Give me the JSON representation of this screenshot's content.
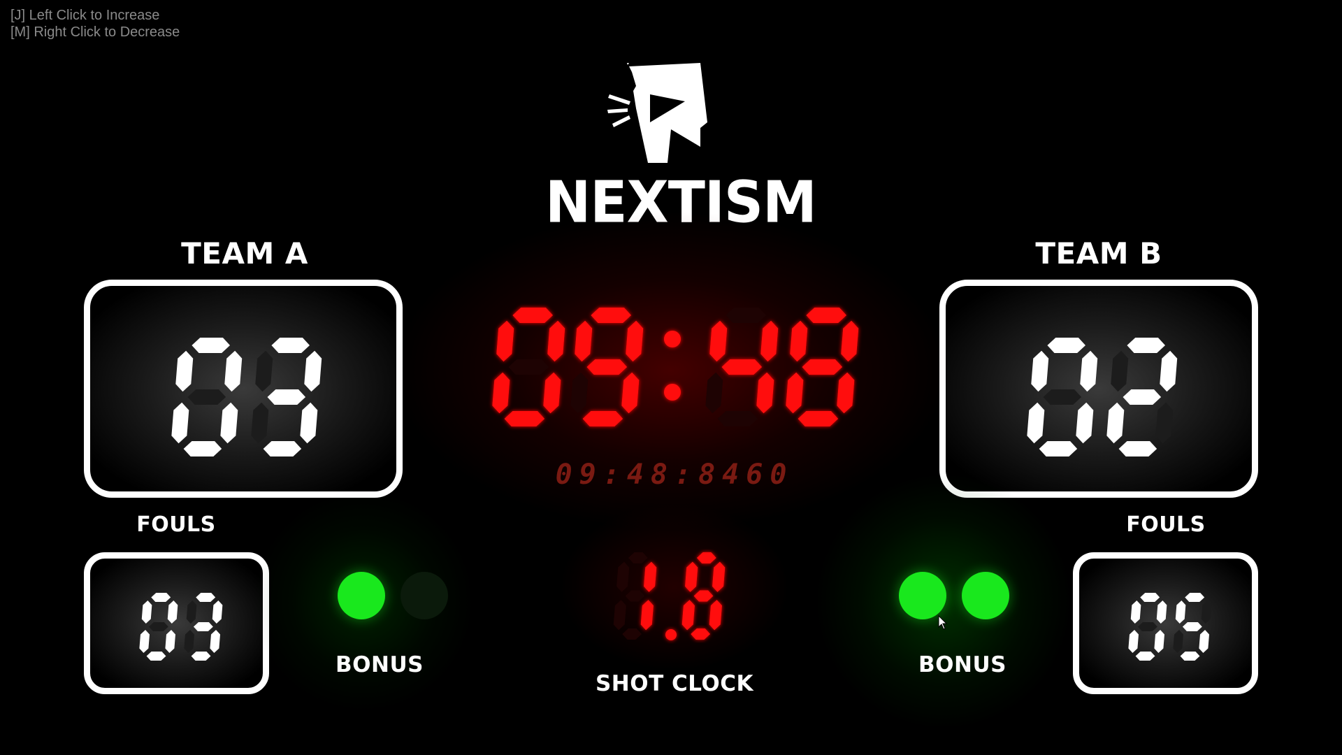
{
  "hints": {
    "increase": "[J] Left Click to Increase",
    "decrease": "[M] Right Click to Decrease"
  },
  "logo": {
    "icon": "nextism-logo-icon",
    "wordmark": "NEXTISM"
  },
  "team_a": {
    "name": "TEAM A",
    "score": "03",
    "fouls_label": "FOULS",
    "fouls": "03",
    "bonus_label": "BONUS",
    "bonus_lights": [
      true,
      false
    ]
  },
  "team_b": {
    "name": "TEAM B",
    "score": "02",
    "fouls_label": "FOULS",
    "fouls": "05",
    "bonus_label": "BONUS",
    "bonus_lights": [
      true,
      true
    ]
  },
  "game_clock": {
    "minutes": "09",
    "seconds": "48",
    "detail": "09:48:8460"
  },
  "shot_clock": {
    "label": "SHOT CLOCK",
    "whole": "1",
    "tenths": "8"
  },
  "colors": {
    "clock_red": "#ff1111",
    "clock_dim": "#1e0303",
    "detail_red": "#7a1a12",
    "digit_white": "#ffffff",
    "digit_dim": "#1c1c1c",
    "bonus_green": "#19e81d"
  }
}
